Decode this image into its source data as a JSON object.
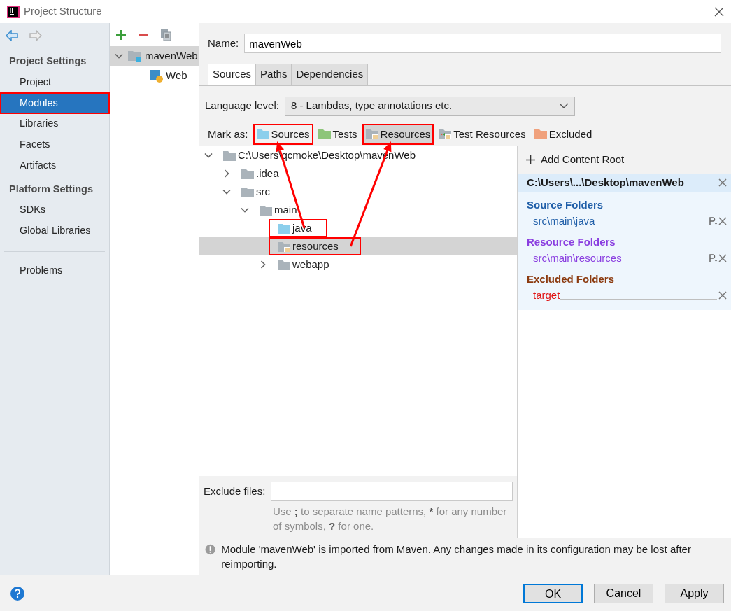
{
  "window": {
    "title": "Project Structure"
  },
  "nav": {
    "back_enabled": true,
    "forward_enabled": false
  },
  "sidebar": [
    {
      "kind": "header",
      "label": "Project Settings"
    },
    {
      "kind": "item",
      "label": "Project",
      "selected": false,
      "annotated": false
    },
    {
      "kind": "item",
      "label": "Modules",
      "selected": true,
      "annotated": true
    },
    {
      "kind": "item",
      "label": "Libraries",
      "selected": false,
      "annotated": false
    },
    {
      "kind": "item",
      "label": "Facets",
      "selected": false,
      "annotated": false
    },
    {
      "kind": "item",
      "label": "Artifacts",
      "selected": false,
      "annotated": false
    },
    {
      "kind": "header",
      "label": "Platform Settings"
    },
    {
      "kind": "item",
      "label": "SDKs",
      "selected": false,
      "annotated": false
    },
    {
      "kind": "item",
      "label": "Global Libraries",
      "selected": false,
      "annotated": false
    },
    {
      "kind": "divider"
    },
    {
      "kind": "item",
      "label": "Problems",
      "selected": false,
      "annotated": false
    }
  ],
  "modules": [
    {
      "label": "mavenWeb",
      "kind": "module",
      "expanded": true,
      "selected": true,
      "children": [
        {
          "label": "Web",
          "kind": "facet",
          "selected": false
        }
      ]
    }
  ],
  "name": {
    "label": "Name:",
    "value": "mavenWeb"
  },
  "tabs": [
    {
      "label": "Sources",
      "selected": true
    },
    {
      "label": "Paths",
      "selected": false
    },
    {
      "label": "Dependencies",
      "selected": false
    }
  ],
  "language_level": {
    "label": "Language level:",
    "value": "8 - Lambdas, type annotations etc."
  },
  "mark_as": {
    "label": "Mark as:",
    "buttons": [
      {
        "label": "Sources",
        "kind": "source",
        "selected": false,
        "annotated": true,
        "arrow": true
      },
      {
        "label": "Tests",
        "kind": "test",
        "selected": false,
        "annotated": false
      },
      {
        "label": "Resources",
        "kind": "resource",
        "selected": true,
        "annotated": true,
        "arrow": true
      },
      {
        "label": "Test Resources",
        "kind": "test_resource",
        "selected": false,
        "annotated": false
      },
      {
        "label": "Excluded",
        "kind": "excluded",
        "selected": false,
        "annotated": false
      }
    ]
  },
  "tree": [
    {
      "label": "C:\\Users\\qcmoke\\Desktop\\mavenWeb",
      "kind": "plain",
      "expanded": true,
      "selected": false,
      "children": [
        {
          "label": ".idea",
          "kind": "plain",
          "expanded": false,
          "selected": false
        },
        {
          "label": "src",
          "kind": "plain",
          "expanded": true,
          "selected": false,
          "children": [
            {
              "label": "main",
              "kind": "plain",
              "expanded": true,
              "selected": false,
              "children": [
                {
                  "label": "java",
                  "kind": "source",
                  "selected": false,
                  "annotated": true,
                  "arrow": true
                },
                {
                  "label": "resources",
                  "kind": "resource",
                  "selected": true,
                  "annotated": true,
                  "arrow": true
                },
                {
                  "label": "webapp",
                  "kind": "plain",
                  "expanded": false,
                  "selected": false
                }
              ]
            }
          ]
        }
      ]
    }
  ],
  "exclude_files": {
    "label": "Exclude files:",
    "hint": [
      {
        "text": "Use ",
        "bold": false
      },
      {
        "text": ";",
        "bold": true
      },
      {
        "text": " to separate name patterns, ",
        "bold": false
      },
      {
        "text": "*",
        "bold": true
      },
      {
        "text": " for any number of symbols, ",
        "bold": false
      },
      {
        "text": "?",
        "bold": true
      },
      {
        "text": " for one.",
        "bold": false
      }
    ]
  },
  "content_roots": {
    "add_label": "Add Content Root",
    "root": "C:\\Users\\...\\Desktop\\mavenWeb",
    "groups": [
      {
        "kind": "source",
        "title": "Source Folders",
        "entries": [
          {
            "path": "src\\main\\java",
            "prefix_editable": true
          }
        ]
      },
      {
        "kind": "resource",
        "title": "Resource Folders",
        "entries": [
          {
            "path": "src\\main\\resources",
            "prefix_editable": true
          }
        ]
      },
      {
        "kind": "excluded",
        "title": "Excluded Folders",
        "entries": [
          {
            "path": "target",
            "prefix_editable": false
          }
        ]
      }
    ]
  },
  "note": "Module 'mavenWeb' is imported from Maven. Any changes made in its configuration may be lost after reimporting.",
  "buttons": [
    {
      "label": "OK",
      "default": true
    },
    {
      "label": "Cancel",
      "default": false
    },
    {
      "label": "Apply",
      "default": false
    }
  ]
}
